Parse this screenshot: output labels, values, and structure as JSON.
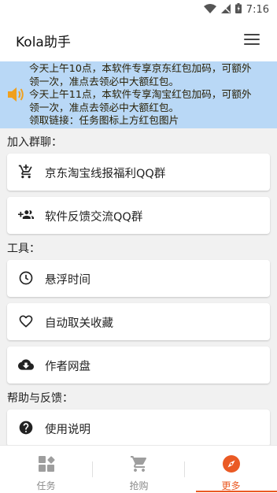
{
  "status_bar": {
    "time": "7:16"
  },
  "app_bar": {
    "title": "Kola助手"
  },
  "notice": {
    "lines": [
      "今天上午10点，本软件专享京东红包加码，可额外",
      "领一次，准点去领必中大额红包。",
      "今天上午11点，本软件专享淘宝红包加码，可额外",
      "领一次，准点去领必中大额红包。",
      "领取链接：任务图标上方红包图片"
    ]
  },
  "sections": {
    "group": {
      "title": "加入群聊：",
      "items": [
        {
          "label": "京东淘宝线报福利QQ群",
          "icon": "cart-add-icon"
        },
        {
          "label": "软件反馈交流QQ群",
          "icon": "group-add-icon"
        }
      ]
    },
    "tools": {
      "title": "工具：",
      "items": [
        {
          "label": "悬浮时间",
          "icon": "clock-icon"
        },
        {
          "label": "自动取关收藏",
          "icon": "heart-icon"
        },
        {
          "label": "作者网盘",
          "icon": "cloud-download-icon"
        }
      ]
    },
    "help": {
      "title": "帮助与反馈：",
      "items": [
        {
          "label": "使用说明",
          "icon": "help-circle-icon"
        }
      ]
    }
  },
  "bottom_nav": {
    "tabs": [
      {
        "label": "任务",
        "icon": "dashboard-icon",
        "active": false
      },
      {
        "label": "抢购",
        "icon": "shopping-cart-icon",
        "active": false
      },
      {
        "label": "更多",
        "icon": "compass-icon",
        "active": true
      }
    ]
  },
  "colors": {
    "notice_bg": "#b9d8f6",
    "accent": "#ea5a24",
    "speaker": "#f0a01e"
  }
}
